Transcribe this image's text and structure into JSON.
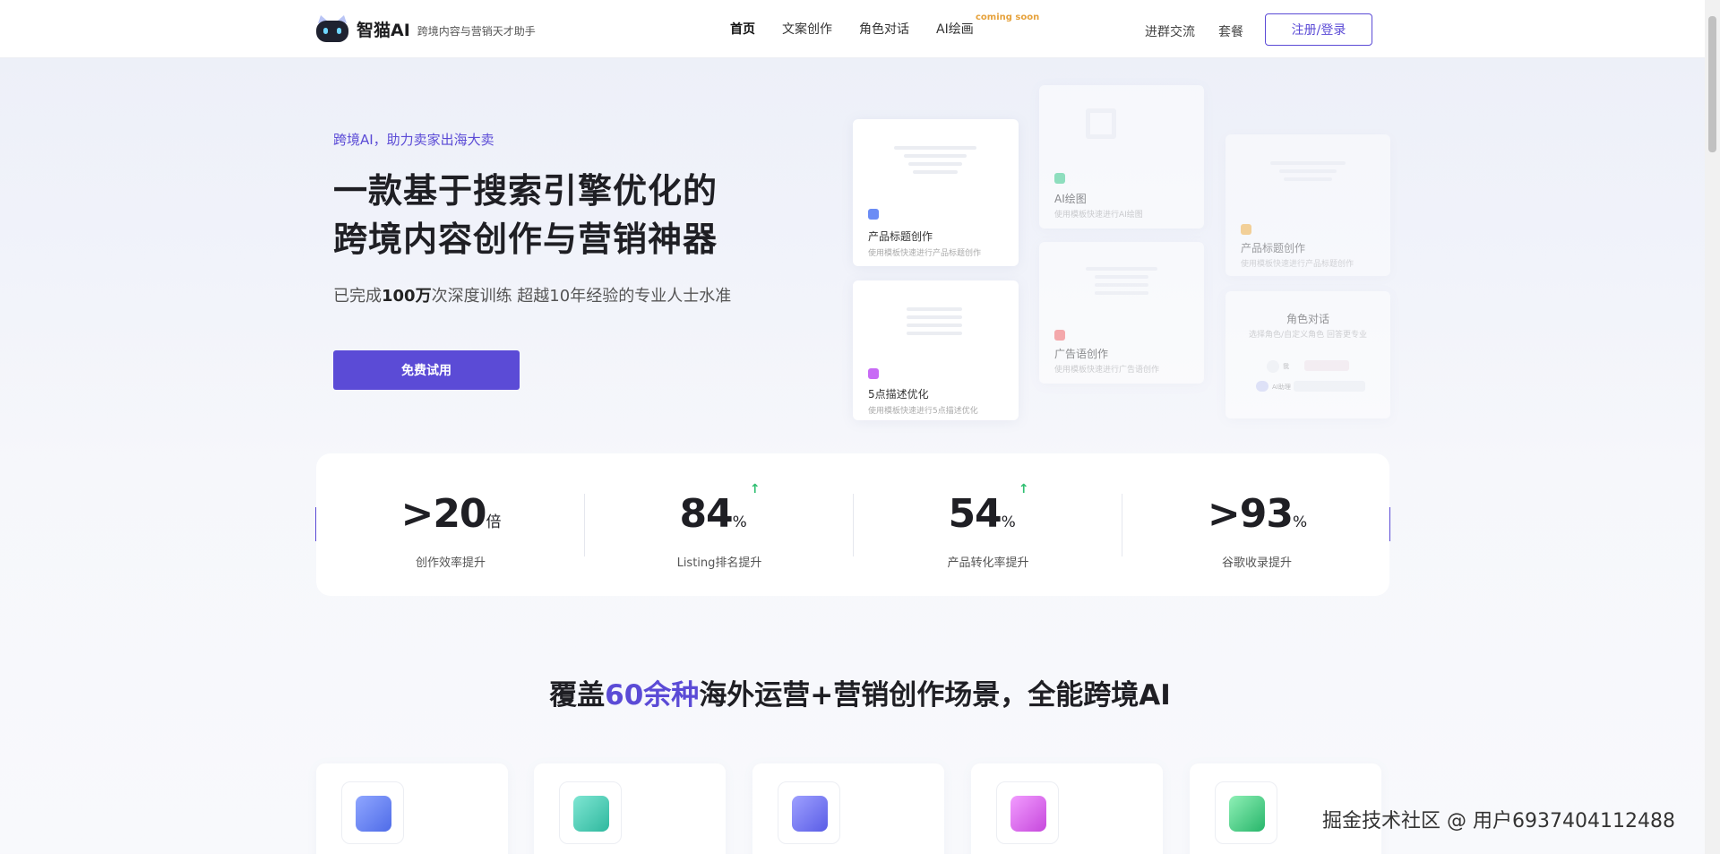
{
  "header": {
    "logo_name": "智猫AI",
    "logo_slogan": "跨境内容与营销天才助手",
    "nav": [
      {
        "label": "首页"
      },
      {
        "label": "文案创作"
      },
      {
        "label": "角色对话"
      },
      {
        "label": "AI绘画",
        "badge": "coming soon"
      }
    ],
    "links": [
      {
        "label": "进群交流"
      },
      {
        "label": "套餐"
      }
    ],
    "login_label": "注册/登录"
  },
  "hero": {
    "subtitle": "跨境AI，助力卖家出海大卖",
    "title_line1": "一款基于搜索引擎优化的",
    "title_line2": "跨境内容创作与营销神器",
    "desc_prefix": "已完成",
    "desc_bold": "100万",
    "desc_suffix": "次深度训练 超越10年经验的专业人士水准",
    "cta_label": "免费试用"
  },
  "cards": [
    {
      "title": "产品标题创作",
      "desc": "使用模板快速进行产品标题创作",
      "icon_color": "#6b8cf5"
    },
    {
      "title": "5点描述优化",
      "desc": "使用模板快速进行5点描述优化",
      "icon_color": "#c86bf5"
    },
    {
      "title": "AI绘图",
      "desc": "使用模板快速进行AI绘图",
      "icon_color": "#3fcf8e"
    },
    {
      "title": "广告语创作",
      "desc": "使用模板快速进行广告语创作",
      "icon_color": "#f56b6b"
    },
    {
      "title": "产品标题创作",
      "desc": "使用模板快速进行产品标题创作",
      "icon_color": "#f5a623"
    },
    {
      "title": "角色对话",
      "desc": "选择角色/自定义角色 回答更专业",
      "user_label": "我",
      "bot_label": "AI助理"
    }
  ],
  "stats": [
    {
      "prefix": ">",
      "value": "20",
      "unit": "倍",
      "label": "创作效率提升",
      "trend": ""
    },
    {
      "prefix": "",
      "value": "84",
      "unit": "%",
      "label": "Listing排名提升",
      "trend": "↑"
    },
    {
      "prefix": "",
      "value": "54",
      "unit": "%",
      "label": "产品转化率提升",
      "trend": "↑"
    },
    {
      "prefix": ">",
      "value": "93",
      "unit": "%",
      "label": "谷歌收录提升",
      "trend": ""
    }
  ],
  "section": {
    "title_prefix": "覆盖",
    "title_highlight": "60余种",
    "title_suffix": "海外运营+营销创作场景，全能跨境AI"
  },
  "features": [
    {
      "icon": "edit-icon",
      "color": "#5b7cf0"
    },
    {
      "icon": "send-icon",
      "color": "#3cc7b0"
    },
    {
      "icon": "document-icon",
      "color": "#6b6ef0"
    },
    {
      "icon": "bag-icon",
      "color": "#d45ae6"
    },
    {
      "icon": "clipboard-icon",
      "color": "#33c27a"
    }
  ],
  "watermark": "掘金技术社区 @ 用户6937404112488",
  "colors": {
    "accent": "#5b4bd6",
    "trend_up": "#2fbf71",
    "badge": "#e6a23c"
  }
}
